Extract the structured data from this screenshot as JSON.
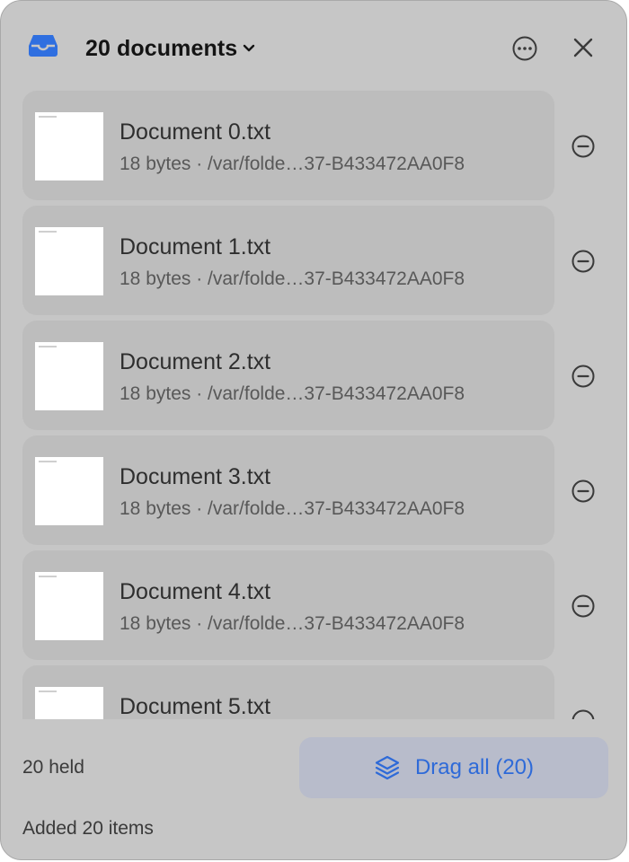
{
  "header": {
    "title": "20 documents",
    "tray_icon": "tray-icon",
    "more_icon": "ellipsis-circle-icon",
    "close_icon": "close-icon",
    "accent": "#2f6fe0"
  },
  "documents": [
    {
      "name": "Document 0.txt",
      "meta": "18 bytes · /var/folde…37-B433472AA0F8"
    },
    {
      "name": "Document 1.txt",
      "meta": "18 bytes · /var/folde…37-B433472AA0F8"
    },
    {
      "name": "Document 2.txt",
      "meta": "18 bytes · /var/folde…37-B433472AA0F8"
    },
    {
      "name": "Document 3.txt",
      "meta": "18 bytes · /var/folde…37-B433472AA0F8"
    },
    {
      "name": "Document 4.txt",
      "meta": "18 bytes · /var/folde…37-B433472AA0F8"
    },
    {
      "name": "Document 5.txt",
      "meta": ""
    }
  ],
  "footer": {
    "held_label": "20 held",
    "drag_label": "Drag all (20)",
    "drag_icon": "stack-icon",
    "status": "Added 20 items"
  }
}
